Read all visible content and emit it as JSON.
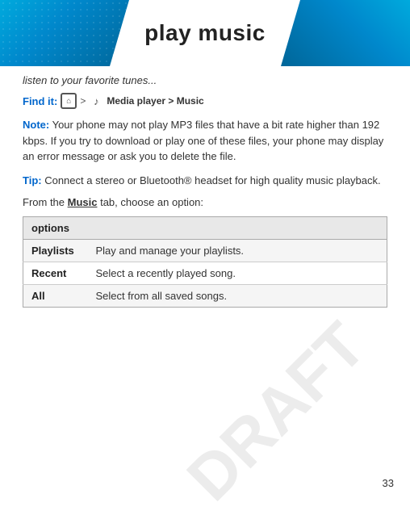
{
  "header": {
    "title": "play music"
  },
  "content": {
    "tagline": "listen to your favorite tunes...",
    "find_it": {
      "label": "Find it:",
      "icon_symbol": "⌂",
      "arrow": ">",
      "music_icon": "♪",
      "path": "Media player > Music"
    },
    "note": {
      "label": "Note:",
      "text": " Your phone may not play MP3 files that have a bit rate higher than 192 kbps. If you try to download or play one of these files, your phone may display an error message or ask you to delete the file."
    },
    "tip": {
      "label": "Tip:",
      "text": " Connect a stereo or Bluetooth® headset for high quality music playback."
    },
    "from_text": "From the ",
    "music_tab_word": "Music",
    "from_text_end": " tab, choose an option:",
    "table": {
      "header": "options",
      "rows": [
        {
          "name": "Playlists",
          "desc": "Play and manage your playlists."
        },
        {
          "name": "Recent",
          "desc": "Select a recently played song."
        },
        {
          "name": "All",
          "desc": "Select from all saved songs."
        }
      ]
    }
  },
  "page_number": "33",
  "draft_label": "DRAFT"
}
